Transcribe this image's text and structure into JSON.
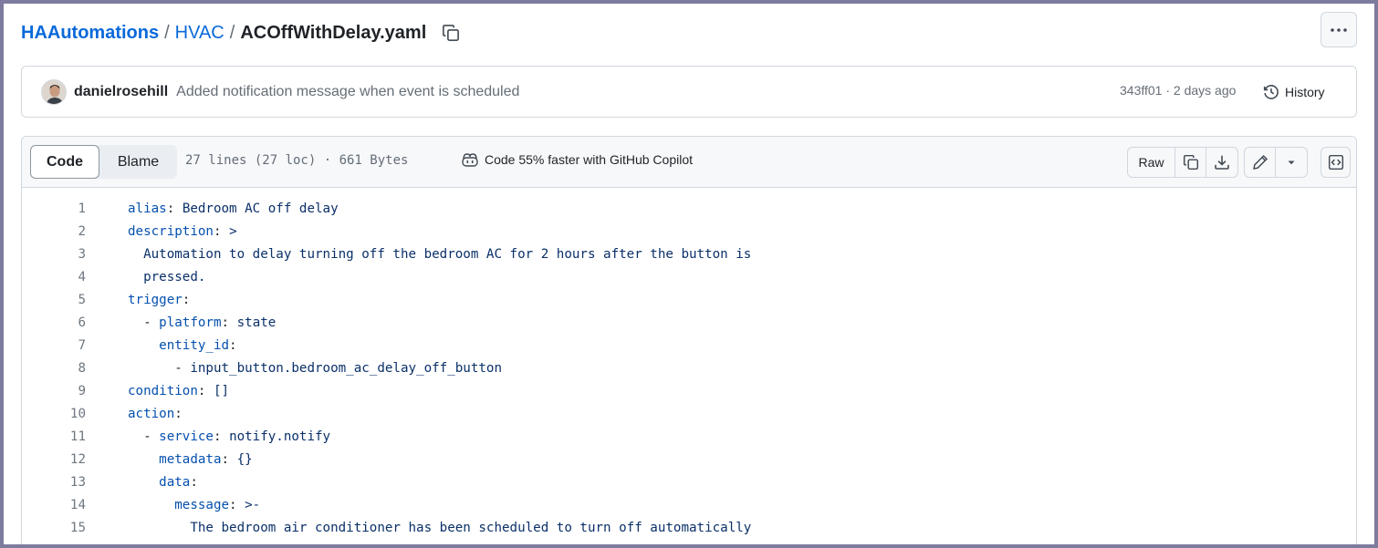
{
  "breadcrumb": {
    "repo": "HAAutomations",
    "separator": "/",
    "dir": "HVAC",
    "file": "ACOffWithDelay.yaml"
  },
  "commit": {
    "author": "danielrosehill",
    "message": "Added notification message when event is scheduled",
    "meta": "343ff01 · 2 days ago",
    "history_label": "History"
  },
  "toolbar": {
    "code_label": "Code",
    "blame_label": "Blame",
    "file_info": "27 lines (27 loc) · 661 Bytes",
    "copilot_label": "Code 55% faster with GitHub Copilot",
    "raw_label": "Raw"
  },
  "icons": {
    "copy": "copy-icon",
    "more": "kebab-horizontal-icon",
    "history": "history-icon",
    "copilot": "copilot-icon",
    "download": "download-icon",
    "edit": "pencil-icon",
    "dropdown": "triangle-down-icon",
    "symbols": "code-square-icon"
  },
  "code_lines": [
    {
      "num": "1",
      "indent": "",
      "key": "alias",
      "sep": ": ",
      "value": "Bedroom AC off delay"
    },
    {
      "num": "2",
      "indent": "",
      "key": "description",
      "sep": ": ",
      "value": ">"
    },
    {
      "num": "3",
      "indent": "  ",
      "key": "",
      "sep": "",
      "value": "Automation to delay turning off the bedroom AC for 2 hours after the button is"
    },
    {
      "num": "4",
      "indent": "  ",
      "key": "",
      "sep": "",
      "value": "pressed."
    },
    {
      "num": "5",
      "indent": "",
      "key": "trigger",
      "sep": ":",
      "value": ""
    },
    {
      "num": "6",
      "indent": "  - ",
      "key": "platform",
      "sep": ": ",
      "value": "state"
    },
    {
      "num": "7",
      "indent": "    ",
      "key": "entity_id",
      "sep": ":",
      "value": ""
    },
    {
      "num": "8",
      "indent": "      - ",
      "key": "",
      "sep": "",
      "value": "input_button.bedroom_ac_delay_off_button"
    },
    {
      "num": "9",
      "indent": "",
      "key": "condition",
      "sep": ": ",
      "value": "[]"
    },
    {
      "num": "10",
      "indent": "",
      "key": "action",
      "sep": ":",
      "value": ""
    },
    {
      "num": "11",
      "indent": "  - ",
      "key": "service",
      "sep": ": ",
      "value": "notify.notify"
    },
    {
      "num": "12",
      "indent": "    ",
      "key": "metadata",
      "sep": ": ",
      "value": "{}"
    },
    {
      "num": "13",
      "indent": "    ",
      "key": "data",
      "sep": ":",
      "value": ""
    },
    {
      "num": "14",
      "indent": "      ",
      "key": "message",
      "sep": ": ",
      "value": ">-"
    },
    {
      "num": "15",
      "indent": "        ",
      "key": "",
      "sep": "",
      "value": "The bedroom air conditioner has been scheduled to turn off automatically"
    }
  ]
}
